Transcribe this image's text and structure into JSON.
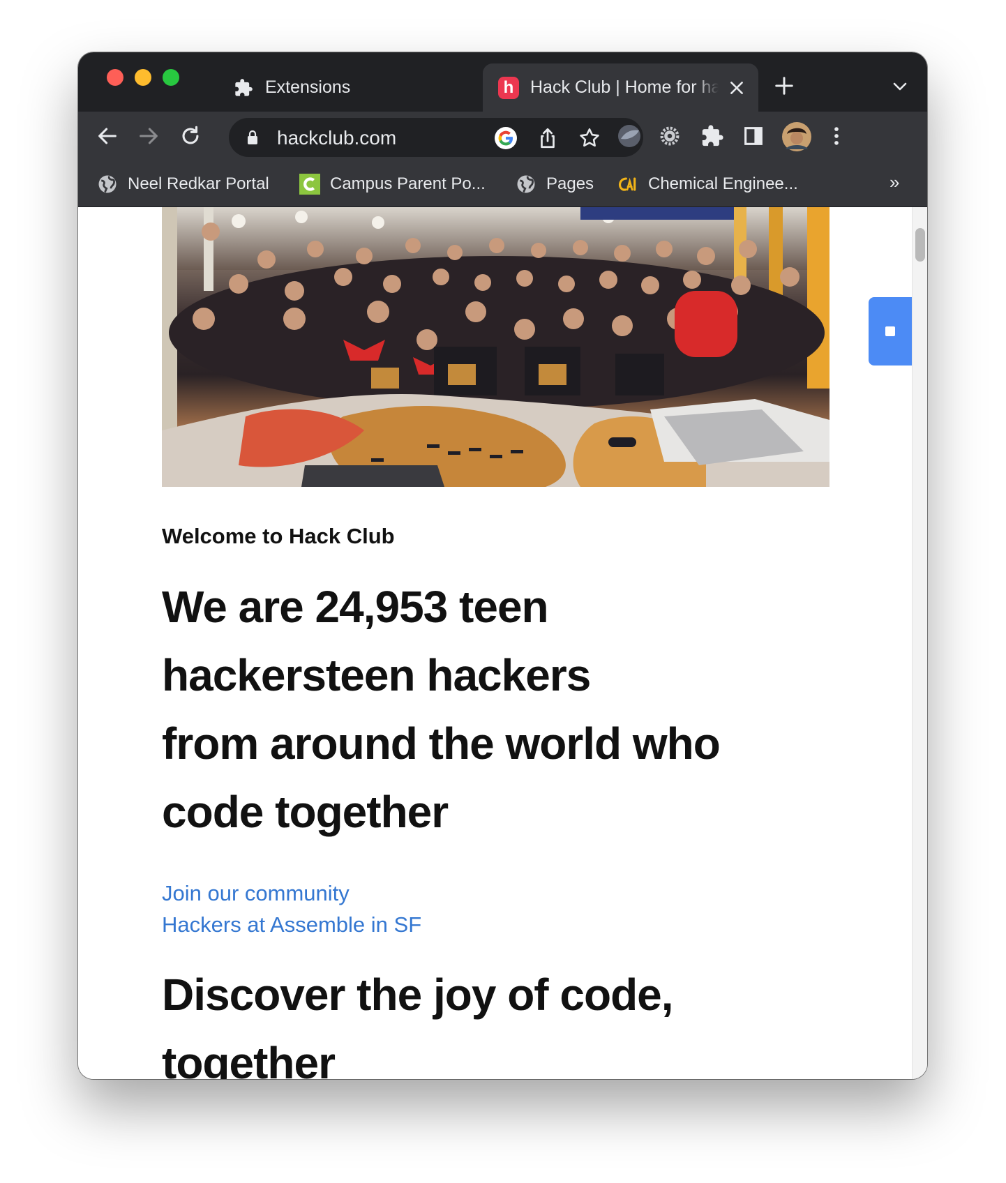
{
  "browser": {
    "tabs": [
      {
        "title": "Extensions",
        "icon": "puzzle-icon"
      },
      {
        "title": "Hack Club | Home for hackers",
        "icon": "hack-club-logo-icon",
        "active": true
      }
    ],
    "hack_club_logo_letter": "h",
    "url": "hackclub.com",
    "bookmarks": [
      {
        "label": "Neel Redkar Portal",
        "icon": "globe-icon"
      },
      {
        "label": "Campus Parent Po...",
        "icon": "campus-c-icon"
      },
      {
        "label": "Pages",
        "icon": "globe-icon"
      },
      {
        "label": "Chemical Enginee...",
        "icon": "cal-logo-icon"
      }
    ],
    "bookmarks_overflow": "»",
    "colors": {
      "tabstrip": "#202124",
      "toolbar": "#35363a",
      "hack_club_red": "#ec3750"
    }
  },
  "page": {
    "hero_image_alt": "Hackers at Assemble in SF",
    "welcome": "Welcome to Hack Club",
    "headline": {
      "line1": "We are 24,953 teen",
      "line2": "hackersteen hackers",
      "line3": "from around the world who",
      "line4": "code together"
    },
    "links": {
      "join": "Join our community",
      "assemble": "Hackers at Assemble in SF"
    },
    "headline2": {
      "line1": "Discover the joy of code,",
      "line2": "together"
    },
    "colors": {
      "link": "#3477d1",
      "floating_button": "#4c8bf5"
    }
  }
}
